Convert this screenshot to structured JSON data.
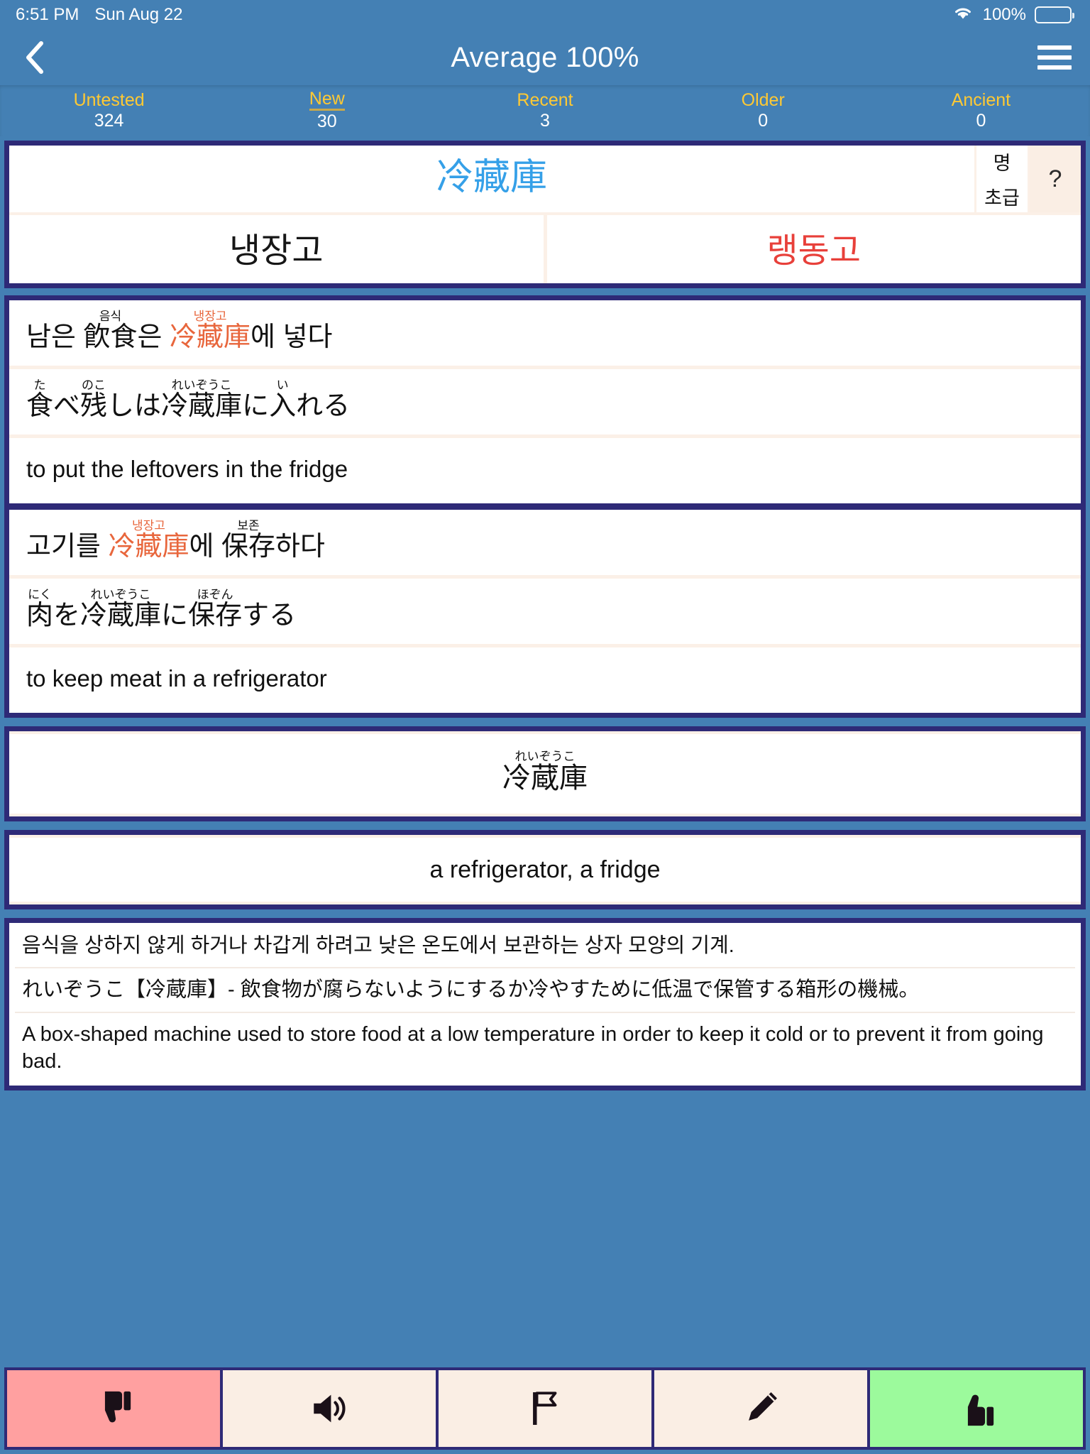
{
  "status_bar": {
    "time": "6:51 PM",
    "date": "Sun Aug 22",
    "battery_percent": "100%",
    "wifi_icon": "wifi-icon",
    "battery_icon": "battery-icon"
  },
  "nav": {
    "back_icon": "back-chevron-icon",
    "title": "Average 100%",
    "menu_icon": "hamburger-menu-icon"
  },
  "stats": [
    {
      "label": "Untested",
      "value": "324",
      "selected": false
    },
    {
      "label": "New",
      "value": "30",
      "selected": true
    },
    {
      "label": "Recent",
      "value": "3",
      "selected": false
    },
    {
      "label": "Older",
      "value": "0",
      "selected": false
    },
    {
      "label": "Ancient",
      "value": "0",
      "selected": false
    }
  ],
  "question": {
    "headword": "冷藏庫",
    "headword_color": "#35a0e8",
    "tag_pos": "명",
    "tag_level": "초급",
    "help_label": "?",
    "answers": [
      {
        "text": "냉장고",
        "color": "black"
      },
      {
        "text": "랭동고",
        "color": "red"
      }
    ]
  },
  "examples": [
    {
      "korean": {
        "prefix": "남은 ",
        "ruby1_base": "飮食",
        "ruby1_rt": "음식",
        "mid": "은 ",
        "target_base": "冷藏庫",
        "target_rt": "냉장고",
        "suffix": "에 넣다"
      },
      "japanese": {
        "r1_base": "食",
        "r1_rt": "た",
        "t1": "べ",
        "r2_base": "残",
        "r2_rt": "のこ",
        "t2": "しは",
        "r3_base": "冷蔵庫",
        "r3_rt": "れいぞうこ",
        "t3": "に",
        "r4_base": "入",
        "r4_rt": "い",
        "t4": "れる"
      },
      "english": "to put the leftovers in the fridge"
    },
    {
      "korean": {
        "prefix": "고기를 ",
        "target_base": "冷藏庫",
        "target_rt": "냉장고",
        "mid": "에 ",
        "ruby2_base": "保存",
        "ruby2_rt": "보존",
        "suffix": "하다"
      },
      "japanese": {
        "r1_base": "肉",
        "r1_rt": "にく",
        "t1": "を",
        "r2_base": "冷蔵庫",
        "r2_rt": "れいぞうこ",
        "t2": "に",
        "r3_base": "保存",
        "r3_rt": "ほぞん",
        "t3": "する"
      },
      "english": "to keep meat in a refrigerator"
    }
  ],
  "reading": {
    "base": "冷蔵庫",
    "rt": "れいぞうこ"
  },
  "meaning": "a refrigerator, a fridge",
  "definition": {
    "korean": "음식을 상하지 않게 하거나 차갑게 하려고 낮은 온도에서 보관하는 상자 모양의 기계.",
    "japanese": "れいぞうこ【冷蔵庫】- 飲食物が腐らないようにするか冷やすために低温で保管する箱形の機械。",
    "english": "A box-shaped machine used to store food at a low temperature in order to keep it cold or to prevent it from going bad."
  },
  "toolbar": [
    {
      "name": "thumbs-down-button",
      "icon": "thumbs-down-icon",
      "style": "neg"
    },
    {
      "name": "audio-button",
      "icon": "speaker-icon",
      "style": ""
    },
    {
      "name": "flag-button",
      "icon": "flag-icon",
      "style": ""
    },
    {
      "name": "edit-button",
      "icon": "pencil-icon",
      "style": ""
    },
    {
      "name": "thumbs-up-button",
      "icon": "thumbs-up-icon",
      "style": "pos"
    }
  ],
  "colors": {
    "background": "#4480b4",
    "card_border": "#2e2a77",
    "accent_yellow": "#ffc933",
    "target_orange": "#e8663c",
    "answer_red": "#e8403a",
    "headword_blue": "#35a0e8",
    "toolbar_cream": "#faeee4",
    "negative": "#ffa0a0",
    "positive": "#9cfa9c"
  }
}
